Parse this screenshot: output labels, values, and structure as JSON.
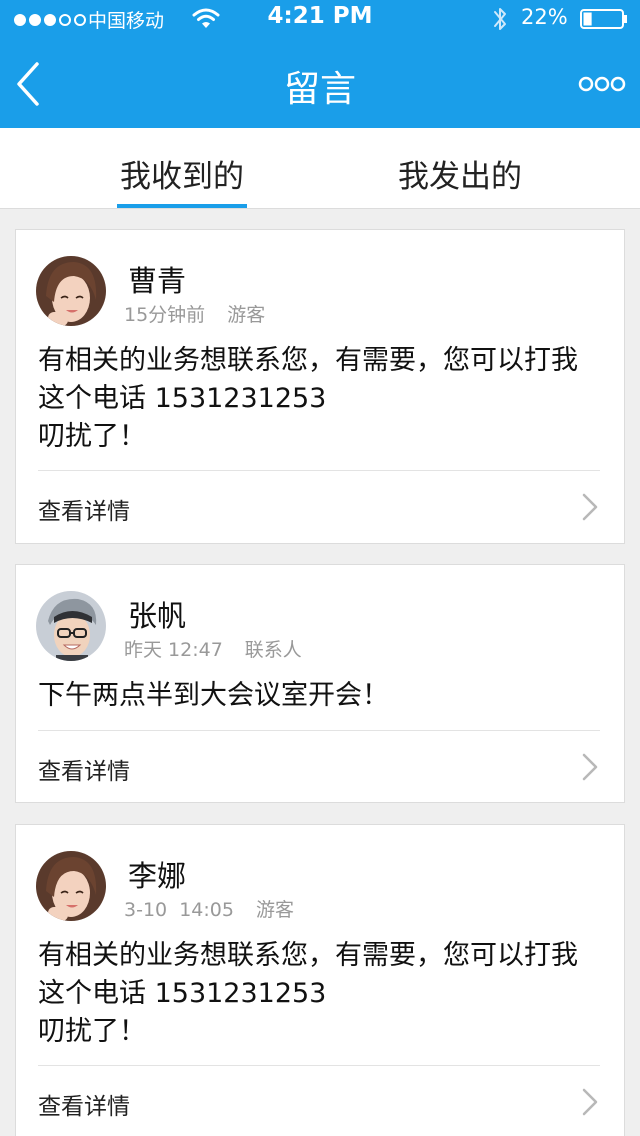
{
  "status_bar": {
    "carrier": "中国移动",
    "time": "4:21 PM",
    "battery": "22%",
    "signal_bars_filled": 3,
    "signal_bars_total": 5,
    "battery_level": 0.22
  },
  "nav": {
    "title": "留言",
    "back_icon": "back-chevron-icon",
    "more_icon": "more-dots-icon"
  },
  "tabs": [
    {
      "label": "我收到的",
      "active": true
    },
    {
      "label": "我发出的",
      "active": false
    }
  ],
  "messages": [
    {
      "name": "曹青",
      "time": "15分钟前",
      "role": "游客",
      "lines": [
        "有相关的业务想联系您，有需要，您可以打我",
        "这个电话 1531231253",
        "叨扰了！"
      ],
      "detail_label": "查看详情"
    },
    {
      "name": "张帆",
      "time": "昨天 12:47",
      "role": "联系人",
      "lines": [
        "下午两点半到大会议室开会！"
      ],
      "detail_label": "查看详情"
    },
    {
      "name": "李娜",
      "time": "3-10  14:05",
      "role": "游客",
      "lines": [
        "有相关的业务想联系您，有需要，您可以打我",
        "这个电话 1531231253",
        "叨扰了！"
      ],
      "detail_label": "查看详情"
    }
  ],
  "colors": {
    "accent": "#1a9ee9",
    "background": "#efefef",
    "card": "#ffffff",
    "meta_text": "#999999"
  }
}
